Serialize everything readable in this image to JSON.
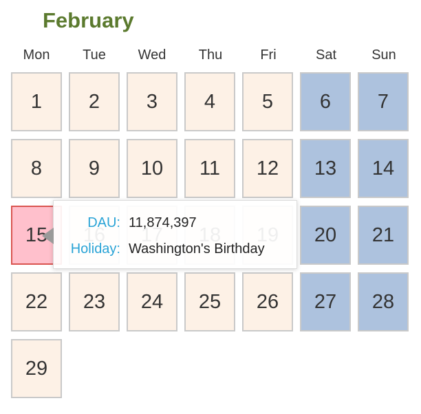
{
  "calendar": {
    "month": "February",
    "weekdays": [
      "Mon",
      "Tue",
      "Wed",
      "Thu",
      "Fri",
      "Sat",
      "Sun"
    ],
    "days": [
      "1",
      "2",
      "3",
      "4",
      "5",
      "6",
      "7",
      "8",
      "9",
      "10",
      "11",
      "12",
      "13",
      "14",
      "15",
      "16",
      "17",
      "18",
      "19",
      "20",
      "21",
      "22",
      "23",
      "24",
      "25",
      "26",
      "27",
      "28",
      "29"
    ],
    "weekend_days": [
      "6",
      "7",
      "13",
      "14",
      "20",
      "21",
      "27",
      "28"
    ],
    "highlighted_day": "15"
  },
  "tooltip": {
    "dau_label": "DAU:",
    "dau_value": "11,874,397",
    "holiday_label": "Holiday:",
    "holiday_value": "Washington's Birthday"
  },
  "colors": {
    "title": "#5b7a2e",
    "weekday_cell": "#fdf1e6",
    "weekend_cell": "#adc2de",
    "holiday_cell": "#ffc0cc",
    "holiday_border": "#d9534f",
    "tooltip_label": "#29a3d6"
  }
}
